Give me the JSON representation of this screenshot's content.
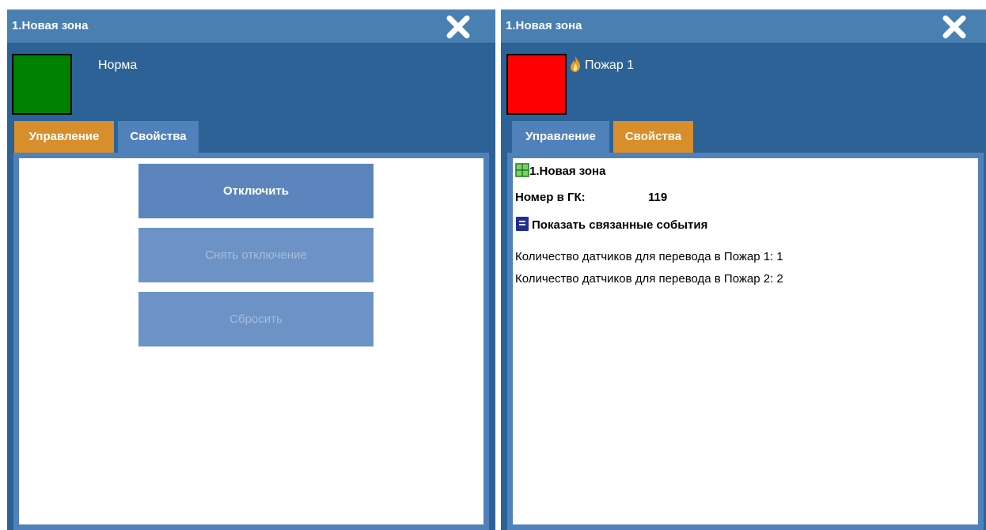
{
  "left_panel": {
    "title": "1.Новая зона",
    "status": "Норма",
    "status_color": "#008000",
    "tabs": [
      {
        "label": "Управление",
        "active": true
      },
      {
        "label": "Свойства",
        "active": false
      }
    ],
    "buttons": [
      {
        "label": "Отключить",
        "enabled": true
      },
      {
        "label": "Снять отключение",
        "enabled": false
      },
      {
        "label": "Сбросить",
        "enabled": false
      }
    ]
  },
  "right_panel": {
    "title": "1.Новая зона",
    "status": "Пожар 1",
    "status_color": "#ff0000",
    "status_icon": "fire-icon",
    "tabs": [
      {
        "label": "Управление",
        "active": false
      },
      {
        "label": "Свойства",
        "active": true
      }
    ],
    "properties": {
      "zone_name": "1.Новая зона",
      "gk_number_label": "Номер в ГК:",
      "gk_number_value": "119",
      "events_link": "Показать связанные события",
      "lines": [
        "Количество датчиков для перевода в Пожар 1: 1",
        "Количество датчиков для перевода в Пожар 2: 2"
      ]
    }
  },
  "colors": {
    "panel_bg": "#2c6296",
    "titlebar_bg": "#4a7fb2",
    "tab_active": "#d88e2a",
    "tab_inactive": "#5181bb",
    "button_bg": "#5c85bd"
  }
}
